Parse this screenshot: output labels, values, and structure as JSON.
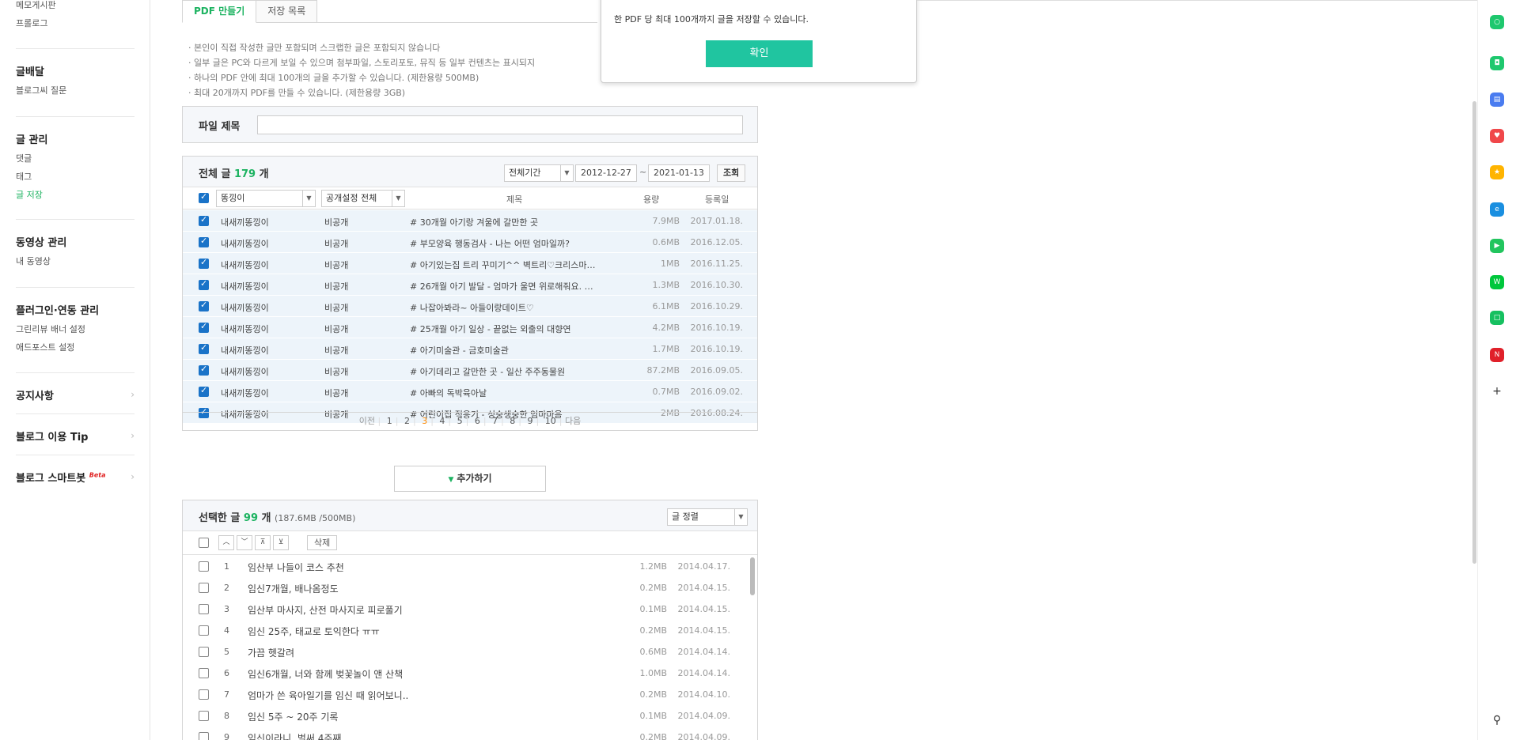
{
  "sidebar": {
    "top_items": [
      "메모게시판",
      "프롤로그"
    ],
    "groups": [
      {
        "title": "글배달",
        "items": [
          "블로그씨 질문"
        ]
      },
      {
        "title": "글 관리",
        "items": [
          "댓글",
          "태그",
          "글 저장"
        ]
      },
      {
        "title": "동영상 관리",
        "items": [
          "내 동영상"
        ]
      },
      {
        "title": "플러그인·연동 관리",
        "items": [
          "그린리뷰 배너 설정",
          "애드포스트 설정"
        ]
      }
    ],
    "links": [
      "공지사항",
      "블로그 이용 Tip",
      "블로그 스마트봇"
    ],
    "beta_label": "Beta",
    "chevron": "›"
  },
  "tabs": [
    "PDF 만들기",
    "저장 목록"
  ],
  "notes": [
    "· 본인이 직접 작성한 글만 포함되며 스크랩한 글은 포함되지 않습니다",
    "· 일부 글은 PC와 다르게 보일 수 있으며 첨부파일, 스토리포토, 뮤직 등 일부 컨텐츠는 표시되지",
    "· 하나의 PDF 안에 최대 100개의 글을 추가할 수 있습니다. (제한용량 500MB)",
    "· 최대 20개까지 PDF를 만들 수 있습니다. (제한용량 3GB)"
  ],
  "file_title_label": "파일 제목",
  "list": {
    "title_prefix": "전체 글",
    "count": "179",
    "unit": "개",
    "period_select": "전체기간",
    "date_from": "2012-12-27",
    "date_sep": "~",
    "date_to": "2021-01-13",
    "search_btn": "조회",
    "writer_select": "똥낑이",
    "visibility_select": "공개설정 전체",
    "col_title": "제목",
    "col_size": "용량",
    "col_date": "등록일",
    "rows": [
      {
        "writer": "내새끼똥낑이",
        "vis": "비공개",
        "title": "# 30개월 아기랑 겨울에 갈만한 곳",
        "size": "7.9MB",
        "date": "2017.01.18."
      },
      {
        "writer": "내새끼똥낑이",
        "vis": "비공개",
        "title": "# 부모양육 행동검사 - 나는 어떤 엄마일까?",
        "size": "0.6MB",
        "date": "2016.12.05."
      },
      {
        "writer": "내새끼똥낑이",
        "vis": "비공개",
        "title": "# 아기있는집 트리 꾸미기^^ 벽트리♡크리스마…",
        "size": "1MB",
        "date": "2016.11.25."
      },
      {
        "writer": "내새끼똥낑이",
        "vis": "비공개",
        "title": "# 26개월 아기 발달 - 엄마가 울면 위로해줘요. …",
        "size": "1.3MB",
        "date": "2016.10.30."
      },
      {
        "writer": "내새끼똥낑이",
        "vis": "비공개",
        "title": "# 나잡아봐라~ 아들이랑데이트♡",
        "size": "6.1MB",
        "date": "2016.10.29."
      },
      {
        "writer": "내새끼똥낑이",
        "vis": "비공개",
        "title": "# 25개월 아기 일상 - 끝없는 외출의 대향연",
        "size": "4.2MB",
        "date": "2016.10.19."
      },
      {
        "writer": "내새끼똥낑이",
        "vis": "비공개",
        "title": "# 아기미술관 - 금호미술관",
        "size": "1.7MB",
        "date": "2016.10.19."
      },
      {
        "writer": "내새끼똥낑이",
        "vis": "비공개",
        "title": "# 아기데리고 갈만한 곳 - 일산 주주동물원",
        "size": "87.2MB",
        "date": "2016.09.05."
      },
      {
        "writer": "내새끼똥낑이",
        "vis": "비공개",
        "title": "# 아빠의 독박육아날",
        "size": "0.7MB",
        "date": "2016.09.02."
      },
      {
        "writer": "내새끼똥낑이",
        "vis": "비공개",
        "title": "# 어린이집 적응기 - 싱숭생숭한 엄마마음",
        "size": "2MB",
        "date": "2016.08.24."
      }
    ],
    "pager": {
      "prev": "이전",
      "pages": [
        "1",
        "2",
        "3",
        "4",
        "5",
        "6",
        "7",
        "8",
        "9",
        "10"
      ],
      "current": "3",
      "next": "다음"
    }
  },
  "add_button": "추가하기",
  "selected": {
    "title_prefix": "선택한 글",
    "count": "99",
    "unit": "개",
    "size_info": "(187.6MB /500MB)",
    "sort_select": "글 정렬",
    "delete_btn": "삭제",
    "rows": [
      {
        "n": "1",
        "title": "임산부 나들이 코스 추천",
        "size": "1.2MB",
        "date": "2014.04.17."
      },
      {
        "n": "2",
        "title": "임신7개월, 배나옴정도",
        "size": "0.2MB",
        "date": "2014.04.15."
      },
      {
        "n": "3",
        "title": "임산부 마사지, 산전 마사지로 피로풀기",
        "size": "0.1MB",
        "date": "2014.04.15."
      },
      {
        "n": "4",
        "title": "임신 25주, 태교로 토익한다 ㅠㅠ",
        "size": "0.2MB",
        "date": "2014.04.15."
      },
      {
        "n": "5",
        "title": "가끔 헷갈려",
        "size": "0.6MB",
        "date": "2014.04.14."
      },
      {
        "n": "6",
        "title": "임신6개월, 너와 함께 벚꽃놀이 앤 산책",
        "size": "1.0MB",
        "date": "2014.04.14."
      },
      {
        "n": "7",
        "title": "엄마가 쓴 육아일기를 임신 때 읽어보니..",
        "size": "0.2MB",
        "date": "2014.04.10."
      },
      {
        "n": "8",
        "title": "임신 5주 ~ 20주 기록",
        "size": "0.1MB",
        "date": "2014.04.09."
      },
      {
        "n": "9",
        "title": "임신이라니, 벌써 4주째",
        "size": "0.2MB",
        "date": "2014.04.09."
      }
    ]
  },
  "popup": {
    "message": "한 PDF 당 최대 100개까지 글을 저장할 수 있습니다.",
    "ok_label": "확인"
  },
  "rail_icons": [
    {
      "name": "green-circle-icon",
      "color": "#1ec86e",
      "glyph": "○"
    },
    {
      "name": "chat-icon",
      "color": "#1ec86e",
      "glyph": "◘"
    },
    {
      "name": "briefcase-icon",
      "color": "#4a7cf0",
      "glyph": "▤"
    },
    {
      "name": "pocket-icon",
      "color": "#f0474a",
      "glyph": "♥"
    },
    {
      "name": "star-icon",
      "color": "#ffb400",
      "glyph": "★"
    },
    {
      "name": "edge-browser-icon",
      "color": "#1a8fe0",
      "glyph": "e"
    },
    {
      "name": "play-icon",
      "color": "#22c55e",
      "glyph": "▶"
    },
    {
      "name": "webtoon-icon",
      "color": "#00c73c",
      "glyph": "W"
    },
    {
      "name": "green-square-icon",
      "color": "#16c060",
      "glyph": "□"
    },
    {
      "name": "news-icon",
      "color": "#e0202a",
      "glyph": "N"
    },
    {
      "name": "add-icon",
      "color": "#ffffff",
      "glyph": "+"
    }
  ],
  "pin_glyph": "⚲",
  "arrow_down": "▼"
}
